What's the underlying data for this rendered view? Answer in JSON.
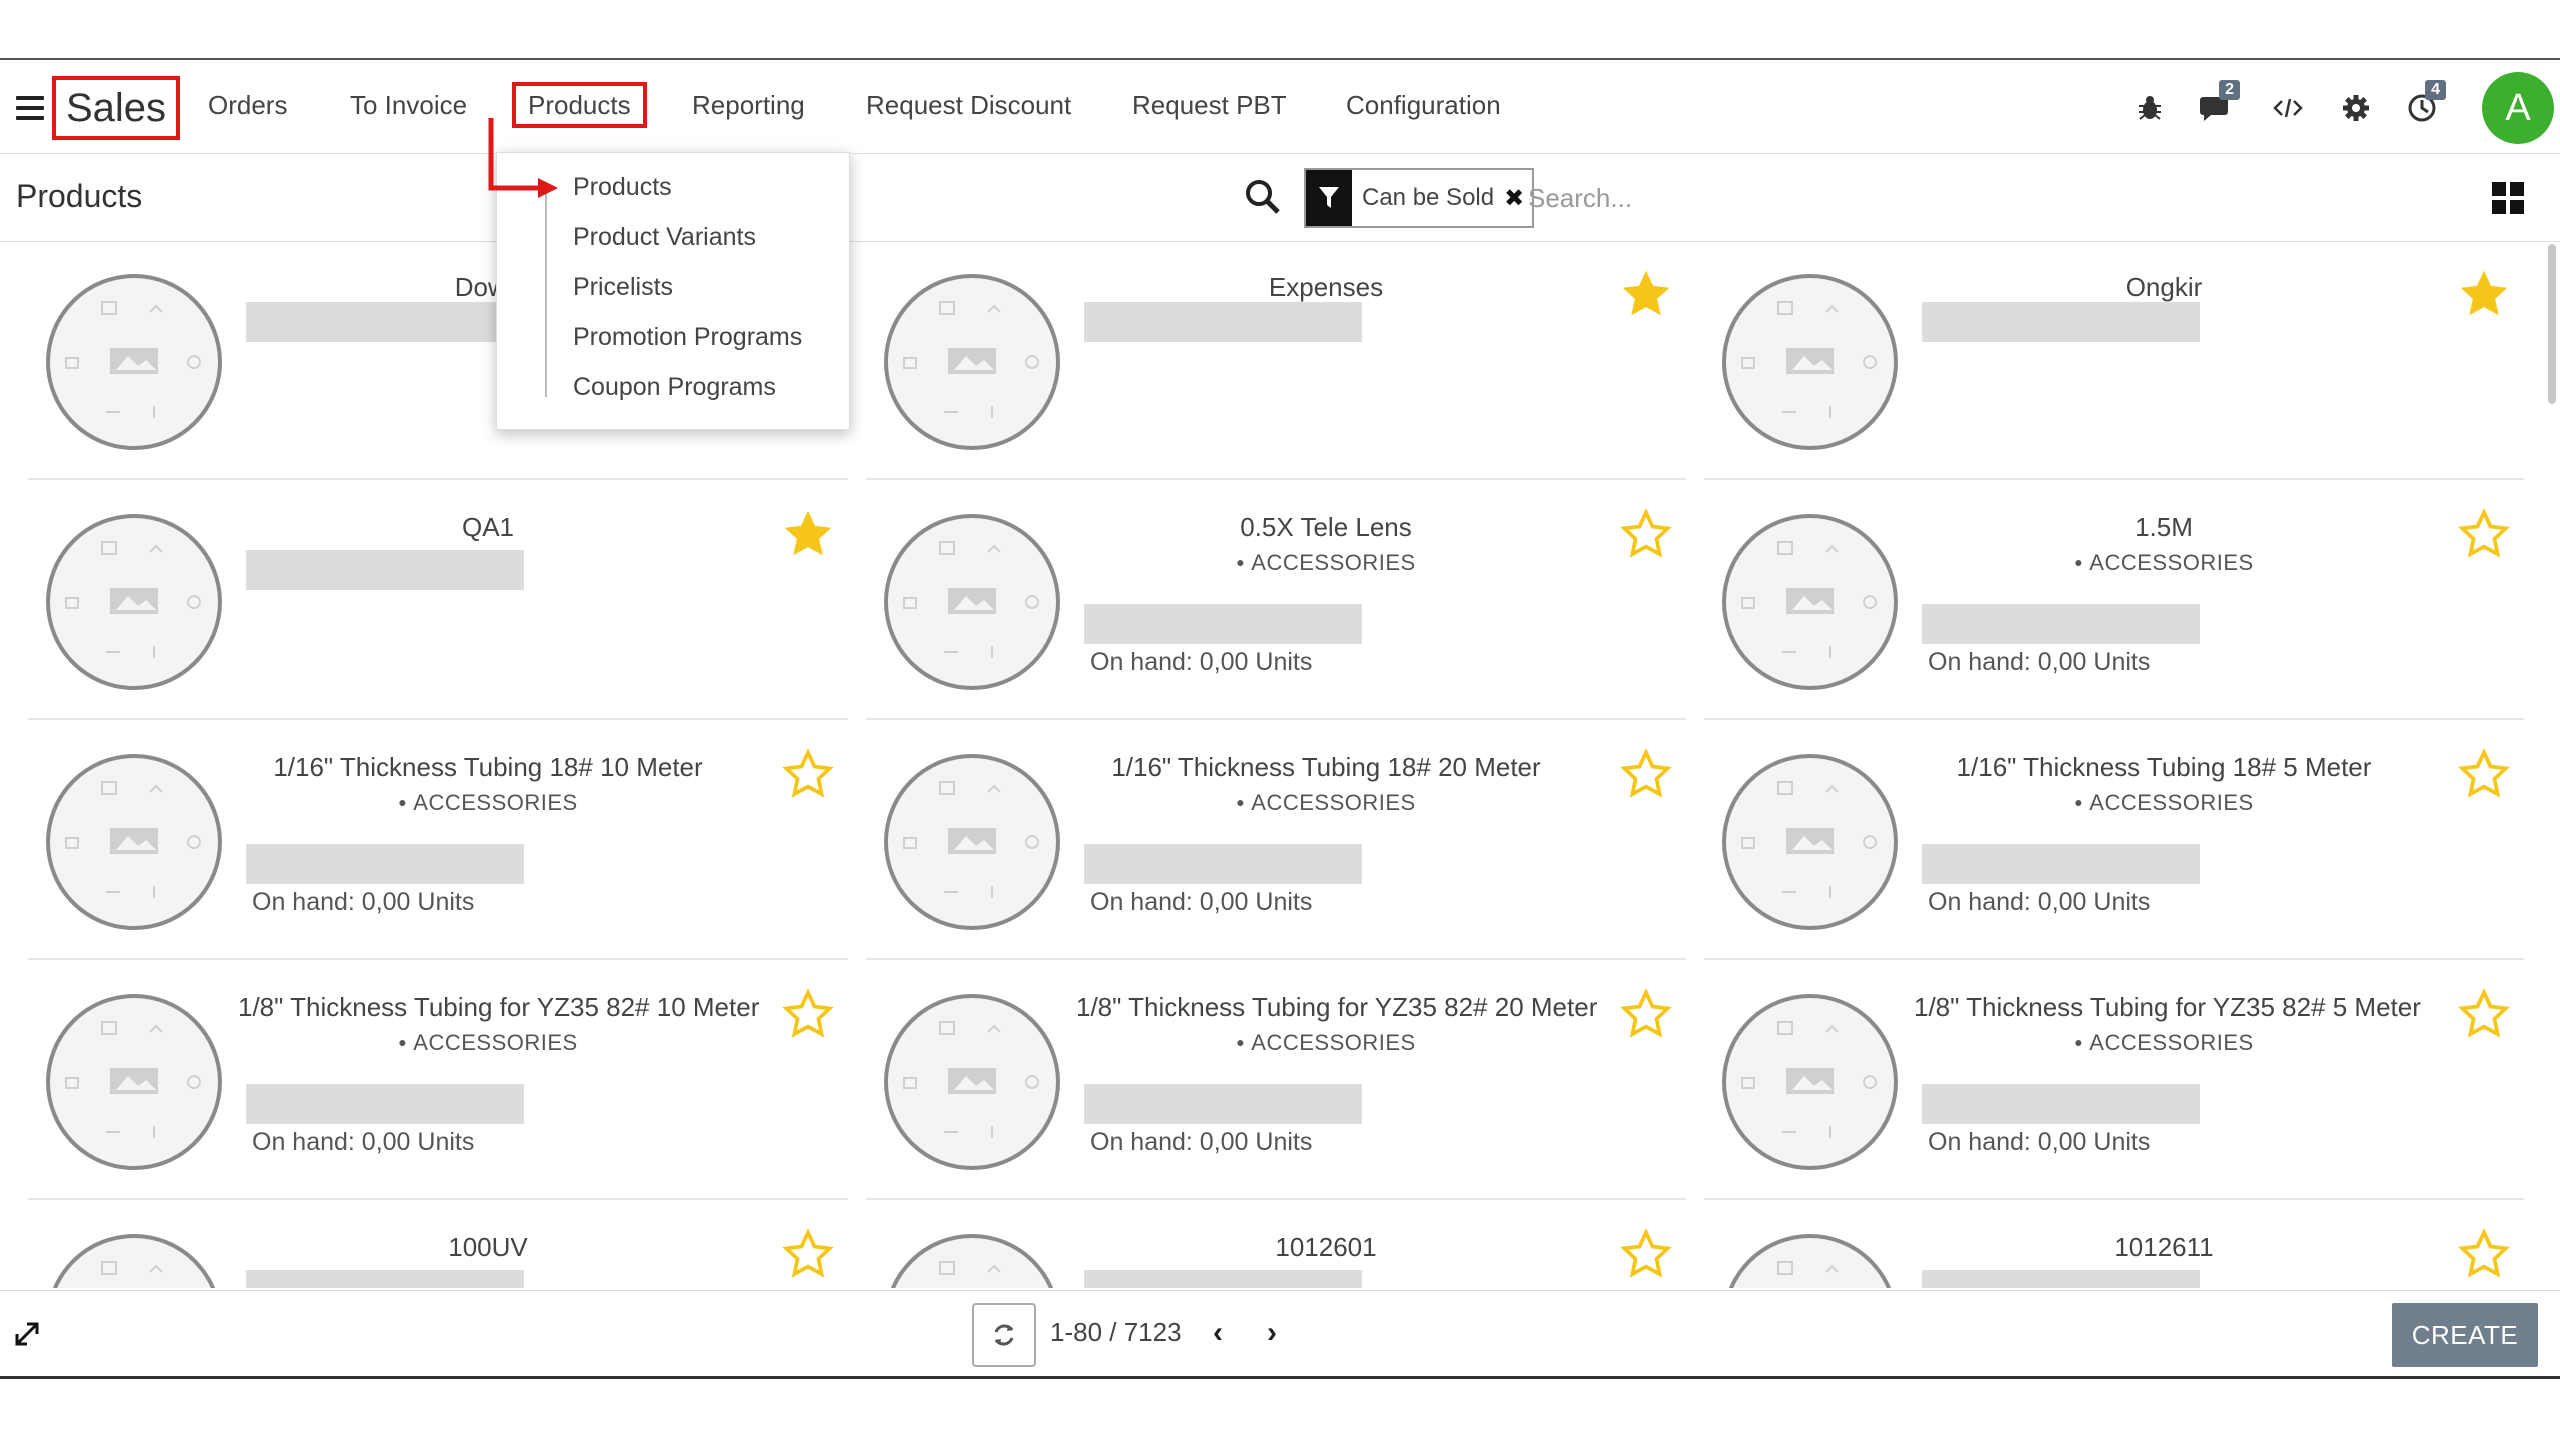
{
  "navbar": {
    "app_name": "Sales",
    "menu": [
      {
        "label": "Orders"
      },
      {
        "label": "To Invoice"
      },
      {
        "label": "Products"
      },
      {
        "label": "Reporting"
      },
      {
        "label": "Request Discount"
      },
      {
        "label": "Request PBT"
      },
      {
        "label": "Configuration"
      }
    ],
    "messages_badge": "2",
    "activities_badge": "4",
    "avatar_letter": "A",
    "avatar_color": "#3cb02e"
  },
  "dropdown": {
    "items": [
      "Products",
      "Product Variants",
      "Pricelists",
      "Promotion Programs",
      "Coupon Programs"
    ]
  },
  "control": {
    "title": "Products",
    "filter_label": "Can be Sold",
    "search_placeholder": "Search..."
  },
  "products": [
    {
      "name": "Down",
      "starred": true
    },
    {
      "name": "Expenses",
      "starred": true
    },
    {
      "name": "Ongkir",
      "starred": true
    },
    {
      "name": "QA1",
      "starred": true
    },
    {
      "name": "0.5X Tele Lens",
      "category": "ACCESSORIES",
      "on_hand": "On hand: 0,00 Units",
      "starred": false
    },
    {
      "name": "1.5M",
      "category": "ACCESSORIES",
      "on_hand": "On hand: 0,00 Units",
      "starred": false
    },
    {
      "name": "1/16\" Thickness Tubing 18# 10 Meter",
      "category": "ACCESSORIES",
      "on_hand": "On hand: 0,00 Units",
      "starred": false
    },
    {
      "name": "1/16\" Thickness Tubing 18# 20 Meter",
      "category": "ACCESSORIES",
      "on_hand": "On hand: 0,00 Units",
      "starred": false
    },
    {
      "name": "1/16\" Thickness Tubing 18# 5 Meter",
      "category": "ACCESSORIES",
      "on_hand": "On hand: 0,00 Units",
      "starred": false
    },
    {
      "name": "1/8\" Thickness Tubing for YZ35 82# 10 Meter",
      "category": "ACCESSORIES",
      "on_hand": "On hand: 0,00 Units",
      "starred": false
    },
    {
      "name": "1/8\" Thickness Tubing for YZ35 82# 20 Meter",
      "category": "ACCESSORIES",
      "on_hand": "On hand: 0,00 Units",
      "starred": false
    },
    {
      "name": "1/8\" Thickness Tubing for YZ35 82# 5 Meter",
      "category": "ACCESSORIES",
      "on_hand": "On hand: 0,00 Units",
      "starred": false
    },
    {
      "name": "100UV",
      "starred": false
    },
    {
      "name": "1012601",
      "starred": false
    },
    {
      "name": "1012611",
      "starred": false
    }
  ],
  "footer": {
    "pager_value": "1-80 / 7123",
    "create_label": "CREATE"
  },
  "colors": {
    "highlight_red": "#e01818",
    "star_yellow": "#f5c518",
    "create_button": "#6f7f8d"
  }
}
